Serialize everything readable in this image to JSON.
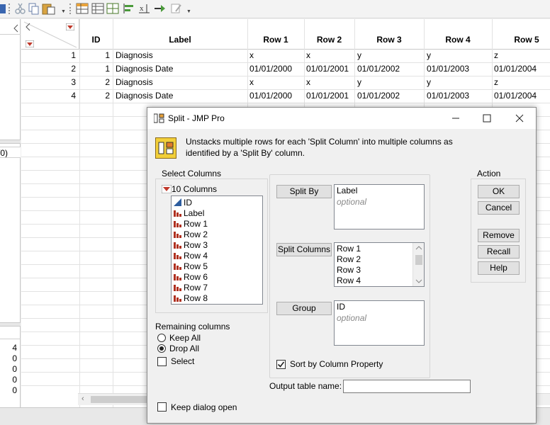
{
  "grid": {
    "columns": [
      "ID",
      "Label",
      "Row 1",
      "Row 2",
      "Row 3",
      "Row 4",
      "Row 5"
    ],
    "rows": [
      {
        "n": "1",
        "id": "1",
        "label": "Diagnosis",
        "r1": "x",
        "r2": "x",
        "r3": "y",
        "r4": "y",
        "r5": "z"
      },
      {
        "n": "2",
        "id": "1",
        "label": "Diagnosis Date",
        "r1": "01/01/2000",
        "r2": "01/01/2001",
        "r3": "01/01/2002",
        "r4": "01/01/2003",
        "r5": "01/01/2004"
      },
      {
        "n": "3",
        "id": "2",
        "label": "Diagnosis",
        "r1": "x",
        "r2": "x",
        "r3": "y",
        "r4": "y",
        "r5": "z"
      },
      {
        "n": "4",
        "id": "2",
        "label": "Diagnosis Date",
        "r1": "01/01/2000",
        "r2": "01/01/2001",
        "r3": "01/01/2002",
        "r4": "01/01/2003",
        "r5": "01/01/2004"
      }
    ]
  },
  "left_panel": {
    "fragment": "/0)",
    "counts": [
      "4",
      "0",
      "0",
      "0",
      "0"
    ]
  },
  "dialog": {
    "title": "Split - JMP Pro",
    "description_line1": "Unstacks multiple rows for each 'Split Column' into multiple columns as",
    "description_line2": "identified by a 'Split By' column.",
    "select_columns": {
      "heading": "Select Columns",
      "count_label": "10 Columns",
      "items": [
        "ID",
        "Label",
        "Row 1",
        "Row 2",
        "Row 3",
        "Row 4",
        "Row 5",
        "Row 6",
        "Row 7",
        "Row 8"
      ]
    },
    "split_by": {
      "button": "Split By",
      "value": "Label",
      "placeholder": "optional"
    },
    "split_columns": {
      "button": "Split Columns",
      "values": [
        "Row 1",
        "Row 2",
        "Row 3",
        "Row 4"
      ]
    },
    "group": {
      "button": "Group",
      "value": "ID",
      "placeholder": "optional"
    },
    "sort_by_property": {
      "label": "Sort by Column Property",
      "checked": true
    },
    "output_table_name": {
      "label": "Output table name:",
      "value": ""
    },
    "remaining": {
      "heading": "Remaining columns",
      "keep_all": "Keep All",
      "drop_all": "Drop All",
      "selected": "Drop All",
      "select": "Select"
    },
    "keep_open": {
      "label": "Keep dialog open",
      "checked": false
    },
    "action": {
      "heading": "Action",
      "ok": "OK",
      "cancel": "Cancel",
      "remove": "Remove",
      "recall": "Recall",
      "help": "Help"
    }
  },
  "colors": {
    "accent_red": "#c0392b",
    "continuous_blue": "#2d5d9f",
    "nominal_red": "#b03020",
    "check_mark": "#222222"
  }
}
